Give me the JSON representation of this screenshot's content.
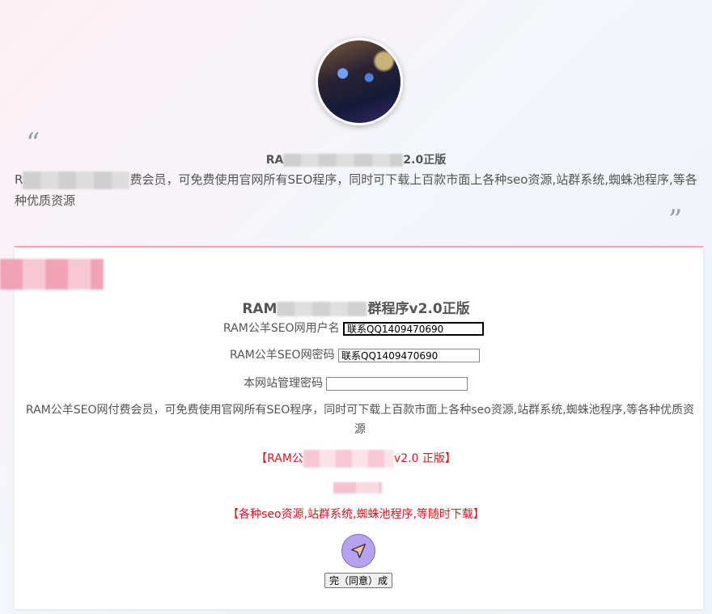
{
  "header": {
    "title_prefix": "RA",
    "title_suffix": "2.0正版",
    "desc_prefix": "R",
    "desc_text": "费会员，可免费使用官网所有SEO程序，同时可下载上百款市面上各种seo资源,站群系统,蜘蛛池程序,等各种优质资源"
  },
  "form": {
    "title_prefix": "RAM",
    "title_suffix": "群程序v2.0正版",
    "username_label": "RAM公羊SEO网用户名",
    "username_value": "联系QQ1409470690",
    "password_label": "RAM公羊SEO网密码",
    "password_value": "联系QQ1409470690",
    "admin_password_label": "本网站管理密码",
    "admin_password_value": "",
    "description": "RAM公羊SEO网付费会员，可免费使用官网所有SEO程序，同时可下载上百款市面上各种seo资源,站群系统,蜘蛛池程序,等各种优质资源",
    "version_prefix": "【RAM公",
    "version_suffix": "v2.0 正版】",
    "resources_note": "【各种seo资源,站群系统,蜘蛛池程序,等随时下载】",
    "agree_label": "完（同意）成"
  },
  "icons": {
    "quote_open": "quote-open-icon",
    "quote_close": "quote-close-icon",
    "send": "send-icon"
  },
  "colors": {
    "accent_red": "#e8131e",
    "button_purple": "#b7a2f0",
    "card_border": "#f4a4b5"
  }
}
